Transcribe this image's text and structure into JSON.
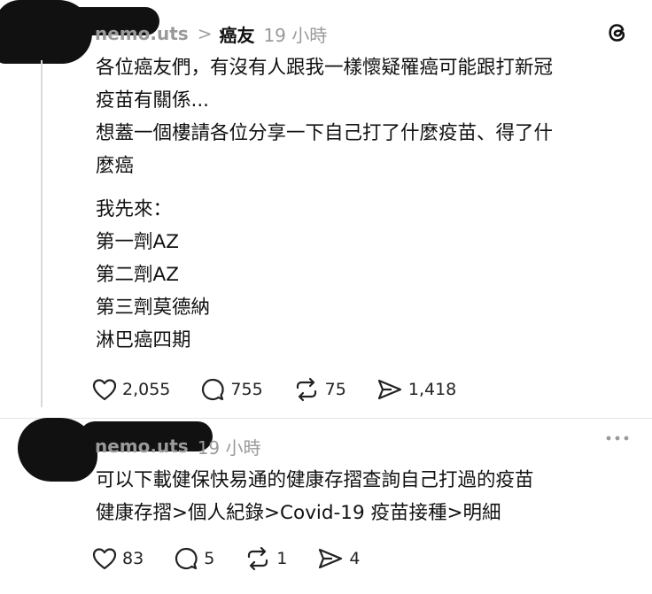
{
  "post1": {
    "username": "nemo.uts",
    "topic": "癌友",
    "time": "19 小時",
    "lines": [
      "各位癌友們，有沒有人跟我一樣懷疑罹癌可能跟打新冠",
      "疫苗有關係...",
      "想蓋一個樓請各位分享一下自己打了什麼疫苗、得了什",
      "麼癌",
      "我先來：",
      "第一劑AZ",
      "第二劑AZ",
      "第三劑莫德納",
      "淋巴癌四期"
    ],
    "likes": "2,055",
    "comments": "755",
    "reposts": "75",
    "shares": "1,418"
  },
  "post2": {
    "username": "nemo.uts",
    "time": "19 小時",
    "lines": [
      "可以下載健保快易通的健康存摺查詢自己打過的疫苗",
      "健康存摺>個人紀錄>Covid-19 疫苗接種>明細"
    ],
    "likes": "83",
    "comments": "5",
    "reposts": "1",
    "shares": "4"
  },
  "icons": {
    "like": "heart-icon",
    "comment": "comment-bubble-icon",
    "repost": "repost-icon",
    "share": "send-icon",
    "app": "threads-logo-icon",
    "more": "more-dots-icon"
  }
}
